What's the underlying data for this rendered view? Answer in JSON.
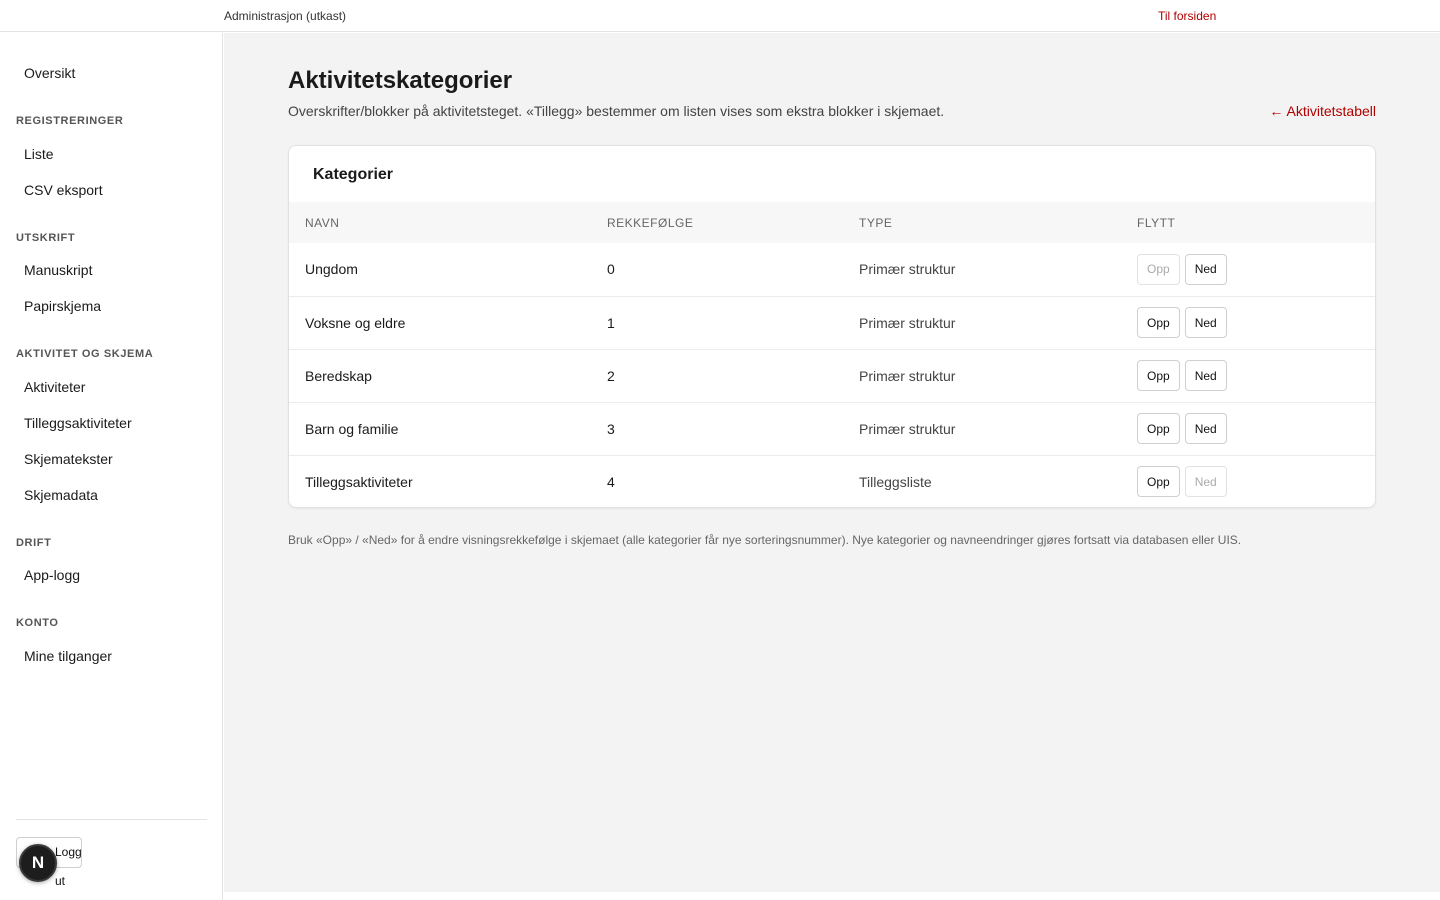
{
  "header": {
    "app_title": "Administrasjon (utkast)",
    "home_link": "Til forsiden"
  },
  "sidebar": {
    "top_items": [
      "Oversikt"
    ],
    "sections": [
      {
        "title": "REGISTRERINGER",
        "items": [
          "Liste",
          "CSV eksport"
        ]
      },
      {
        "title": "UTSKRIFT",
        "items": [
          "Manuskript",
          "Papirskjema"
        ]
      },
      {
        "title": "AKTIVITET OG SKJEMA",
        "items": [
          "Aktiviteter",
          "Tilleggsaktiviteter",
          "Skjematekster",
          "Skjemadata"
        ]
      },
      {
        "title": "DRIFT",
        "items": [
          "App-logg"
        ]
      },
      {
        "title": "KONTO",
        "items": [
          "Mine tilganger"
        ]
      }
    ],
    "logout_label": "Logg ut",
    "badge_letter": "N"
  },
  "main": {
    "title": "Aktivitetskategorier",
    "subtitle": "Overskrifter/blokker på aktivitetsteget. «Tillegg» bestemmer om listen vises som ekstra blokker i skjemaet.",
    "back_link": "← Aktivitetstabell",
    "card_title": "Kategorier",
    "columns": [
      "NAVN",
      "REKKEFØLGE",
      "TYPE",
      "FLYTT"
    ],
    "up_label": "Opp",
    "down_label": "Ned",
    "rows": [
      {
        "name": "Ungdom",
        "order": "0",
        "type": "Primær struktur",
        "up_disabled": true,
        "down_disabled": false
      },
      {
        "name": "Voksne og eldre",
        "order": "1",
        "type": "Primær struktur",
        "up_disabled": false,
        "down_disabled": false
      },
      {
        "name": "Beredskap",
        "order": "2",
        "type": "Primær struktur",
        "up_disabled": false,
        "down_disabled": false
      },
      {
        "name": "Barn og familie",
        "order": "3",
        "type": "Primær struktur",
        "up_disabled": false,
        "down_disabled": false
      },
      {
        "name": "Tilleggsaktiviteter",
        "order": "4",
        "type": "Tilleggsliste",
        "up_disabled": false,
        "down_disabled": true
      }
    ],
    "footnote": "Bruk «Opp» / «Ned» for å endre visningsrekkefølge i skjemaet (alle kategorier får nye sorteringsnummer). Nye kategorier og navneendringer gjøres fortsatt via databasen eller UIS."
  },
  "colors": {
    "accent_red": "#b00000",
    "main_bg": "#f3f3f3",
    "sidebar_bg": "#ffffff"
  }
}
